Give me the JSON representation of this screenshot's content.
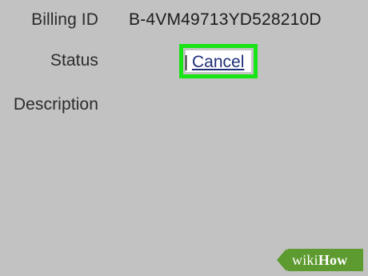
{
  "fields": {
    "billing_id_label": "Billing ID",
    "billing_id_value": "B-4VM49713YD528210D",
    "status_label": "Status",
    "status_separator": "|",
    "status_action": "Cancel",
    "description_label": "Description"
  },
  "watermark": {
    "prefix": "wiki",
    "suffix": "How"
  },
  "colors": {
    "background": "#c2c2c2",
    "highlight": "#17e516",
    "link": "#1f2f7a",
    "watermark": "#5d9a2f"
  }
}
